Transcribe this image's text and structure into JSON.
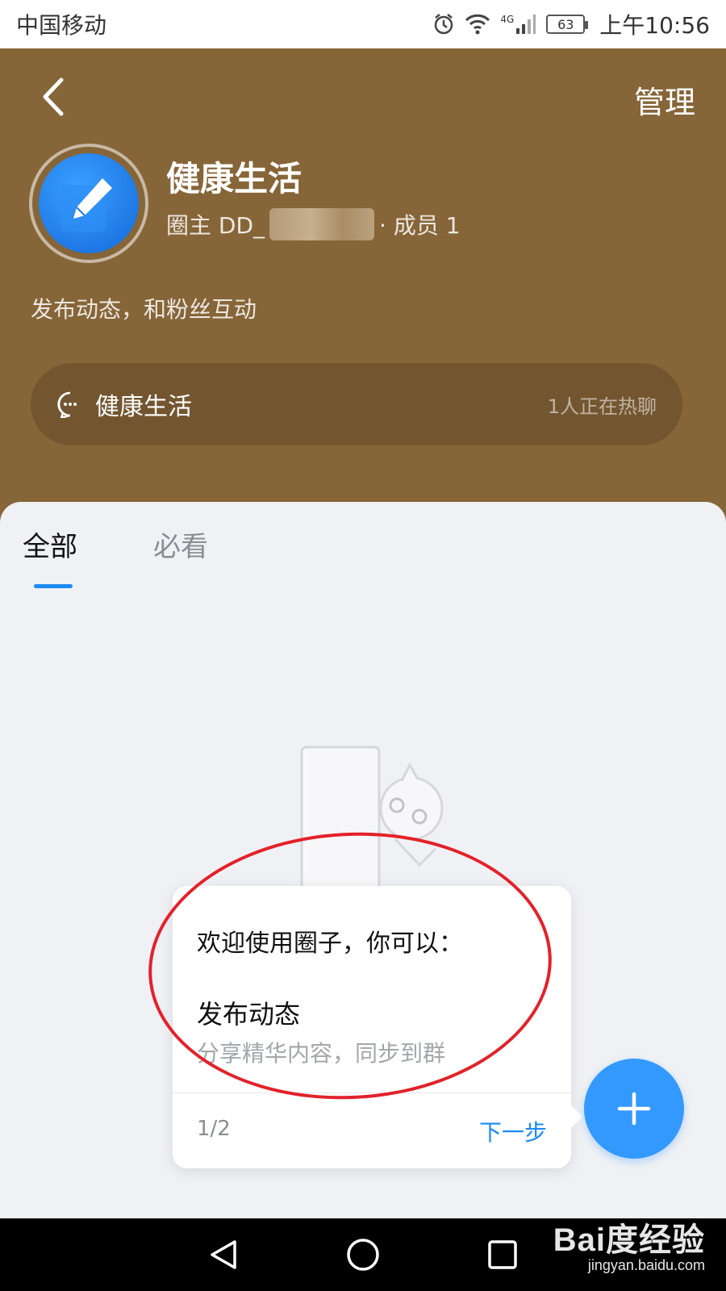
{
  "status_bar": {
    "carrier": "中国移动",
    "network": "4G",
    "battery": "63",
    "time": "上午10:56"
  },
  "header": {
    "manage_label": "管理",
    "circle_name": "健康生活",
    "owner_prefix": "圈主 DD_",
    "members_label": "· 成员 1",
    "description": "发布动态，和粉丝互动",
    "chat": {
      "name": "健康生活",
      "status": "1人正在热聊"
    },
    "background_color": "#866538"
  },
  "tabs": [
    {
      "label": "全部",
      "active": true
    },
    {
      "label": "必看",
      "active": false
    }
  ],
  "guide": {
    "intro": "欢迎使用圈子，你可以：",
    "item_title": "发布动态",
    "item_desc": "分享精华内容，同步到群",
    "page": "1/2",
    "next_label": "下一步"
  },
  "fab": {
    "icon": "plus-icon",
    "color": "#3399ff"
  },
  "accent_color": "#1b8bf2",
  "annotation_color": "#e3212a",
  "watermark": {
    "logo": "Bai度经验",
    "url": "jingyan.baidu.com"
  }
}
